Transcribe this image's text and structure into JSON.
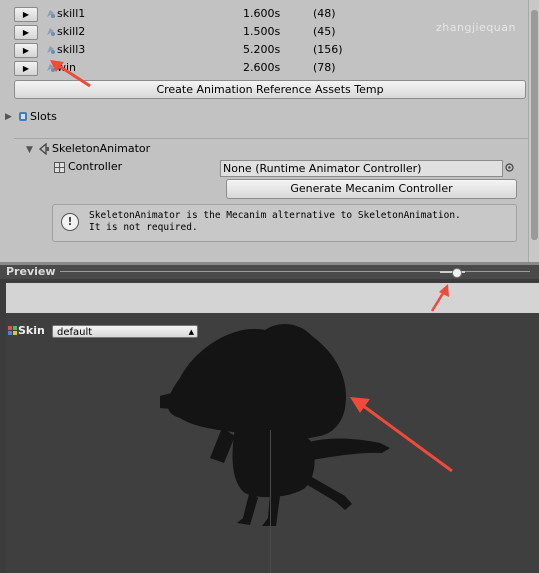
{
  "animations": [
    {
      "name": "skill1",
      "duration": "1.600s",
      "frames": "(48)"
    },
    {
      "name": "skill2",
      "duration": "1.500s",
      "frames": "(45)"
    },
    {
      "name": "skill3",
      "duration": "5.200s",
      "frames": "(156)"
    },
    {
      "name": "win",
      "duration": "2.600s",
      "frames": "(78)"
    }
  ],
  "play_glyph": "▶",
  "create_button_label": "Create Animation Reference Assets Temp",
  "slots_label": "Slots",
  "skeleton_animator": {
    "header": "SkeletonAnimator",
    "controller_label": "Controller",
    "controller_value": "None (Runtime Animator Controller)",
    "generate_button_label": "Generate Mecanim Controller",
    "help_line1": "SkeletonAnimator is the Mecanim alternative to SkeletonAnimation.",
    "help_line2": "It is not required."
  },
  "preview": {
    "label": "Preview",
    "skin_label": "Skin",
    "skin_value": "default"
  },
  "watermark": "zhangjiequan",
  "colors": {
    "annotation_arrow": "#f04a3a"
  }
}
